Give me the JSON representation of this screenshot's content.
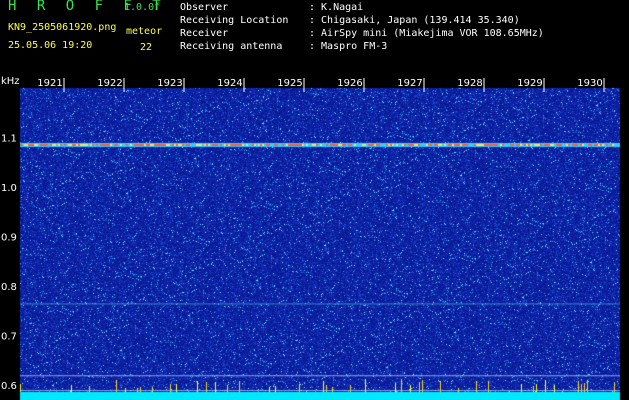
{
  "app": {
    "title": "H R O F F T",
    "version": "1.0.0f",
    "file_name": "KN9_2505061920.png",
    "timestamp": "25.05.06 19:20",
    "meteor_label": "meteor",
    "meteor_count": "22"
  },
  "info": [
    {
      "label": "Observer",
      "value": ": K.Nagai"
    },
    {
      "label": "Receiving Location",
      "value": ": Chigasaki, Japan (139.414 35.340)"
    },
    {
      "label": "Receiver",
      "value": ": AirSpy mini (Miakejima VOR 108.65MHz)"
    },
    {
      "label": "Receiving antenna",
      "value": ": Maspro FM-3"
    }
  ],
  "axes": {
    "y_unit": "kHz",
    "y_ticks": [
      "1.1",
      "1.0",
      "0.9",
      "0.8",
      "0.7",
      "0.6"
    ],
    "y_values": [
      1.1,
      1.0,
      0.9,
      0.8,
      0.7,
      0.6
    ],
    "y_range": [
      0.57,
      1.2
    ],
    "x_ticks": [
      "1921",
      "1922",
      "1923",
      "1924",
      "1925",
      "1926",
      "1927",
      "1928",
      "1929",
      "1930"
    ],
    "x_range": [
      1920.5,
      1930.5
    ]
  },
  "colors": {
    "background": "#1020a8",
    "carrier": "#ff5a3c",
    "title_green": "#39e24b",
    "label_yellow": "#ffff4a",
    "bottom_band": "#00e8ff"
  }
}
